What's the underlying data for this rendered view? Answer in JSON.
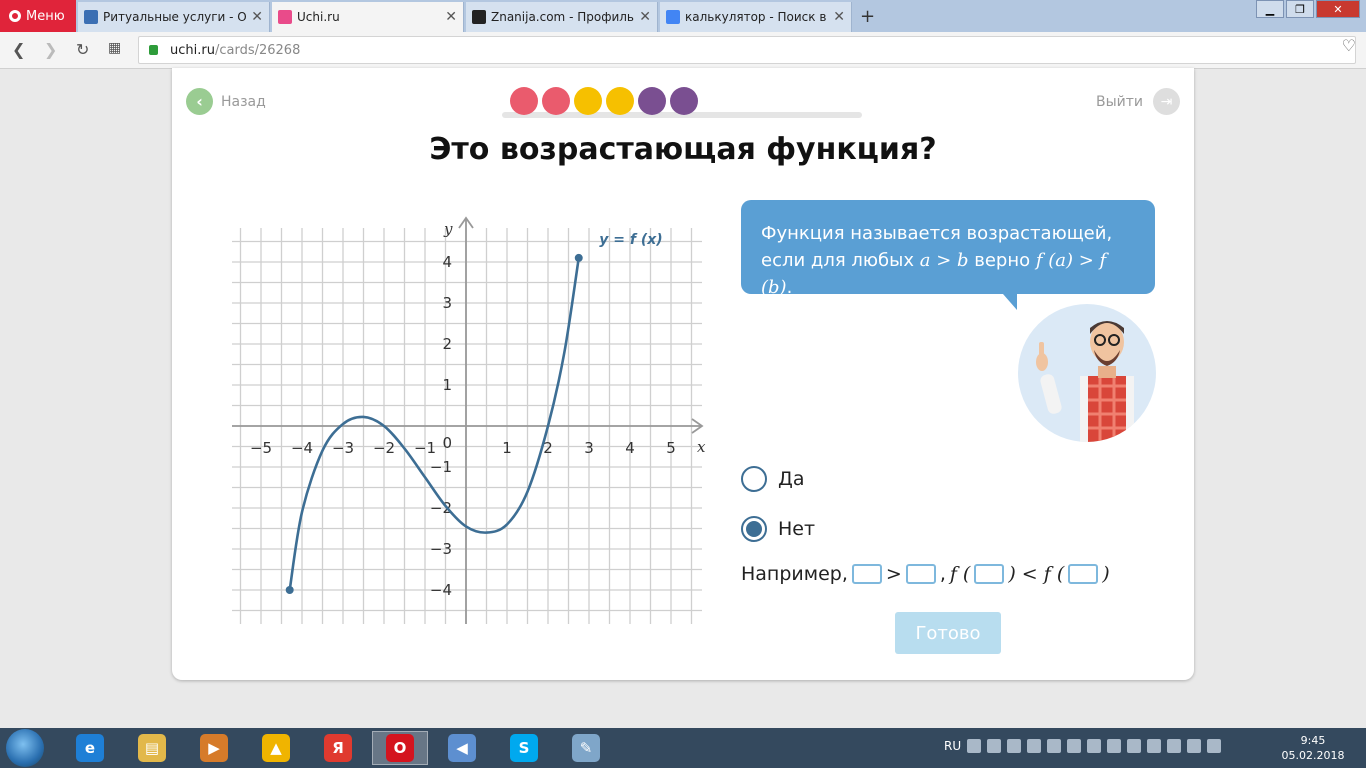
{
  "browser": {
    "menu_label": "Меню",
    "tabs": [
      {
        "title": "Ритуальные услуги - Обр",
        "favicon_color": "#3b6fb3",
        "active": false
      },
      {
        "title": "Uchi.ru",
        "favicon_color": "#e94b8a",
        "active": true
      },
      {
        "title": "Znanija.com - Профиль по",
        "favicon_color": "#222222",
        "active": false
      },
      {
        "title": "калькулятор - Поиск в Go",
        "favicon_color": "#4285f4",
        "active": false
      }
    ],
    "url_host": "uchi.ru",
    "url_path": "/cards/26268"
  },
  "lesson": {
    "back_label": "Назад",
    "exit_label": "Выйти",
    "progress_dot_colors": [
      "#ea5b6d",
      "#ea5b6d",
      "#f6c000",
      "#f6c000",
      "#7a4f91",
      "#7a4f91"
    ],
    "title": "Это возрастающая функция?",
    "hint_line1": "Функция называется возрастающей,",
    "hint_line2_pre": "если для любых ",
    "hint_line2_math1": "a > b",
    "hint_line2_mid": " верно ",
    "hint_line2_math2": "f (a) > f (b)",
    "hint_line2_end": ".",
    "options": [
      {
        "label": "Да",
        "selected": false
      },
      {
        "label": "Нет",
        "selected": true
      }
    ],
    "example_prefix": "Например,",
    "example_gt": ">",
    "example_comma": ",",
    "example_f1": "f (",
    "example_lt": ") < f (",
    "example_close": ")",
    "done_label": "Готово"
  },
  "chart_data": {
    "type": "line",
    "title": "",
    "series_label": "y = f (x)",
    "xlabel": "x",
    "ylabel": "y",
    "origin_label": "0",
    "xlim": [
      -5.5,
      5.5
    ],
    "ylim": [
      -4.7,
      4.6
    ],
    "x_ticks": [
      -5,
      -4,
      -3,
      -2,
      -1,
      1,
      2,
      3,
      4,
      5
    ],
    "x_tick_labels": [
      "−5",
      "−4",
      "−3",
      "−2",
      "−1",
      "1",
      "2",
      "3",
      "4",
      "5"
    ],
    "y_ticks": [
      4,
      3,
      2,
      1,
      -1,
      -2,
      -3,
      -4
    ],
    "y_tick_labels": [
      "4",
      "3",
      "2",
      "1",
      "−1",
      "−2",
      "−3",
      "−4"
    ],
    "grid": true,
    "line_color": "#3d6e94",
    "points": [
      [
        -4.3,
        -4.0
      ],
      [
        -4.0,
        -2.1
      ],
      [
        -3.5,
        -0.6
      ],
      [
        -3.0,
        0.05
      ],
      [
        -2.5,
        0.22
      ],
      [
        -2.0,
        0.0
      ],
      [
        -1.5,
        -0.55
      ],
      [
        -1.0,
        -1.25
      ],
      [
        -0.5,
        -1.95
      ],
      [
        0.0,
        -2.45
      ],
      [
        0.5,
        -2.6
      ],
      [
        1.0,
        -2.4
      ],
      [
        1.5,
        -1.6
      ],
      [
        2.0,
        0.0
      ],
      [
        2.4,
        1.8
      ],
      [
        2.75,
        4.1
      ]
    ]
  },
  "taskbar": {
    "apps": [
      {
        "name": "ie",
        "color": "#1e7fd6",
        "glyph": "e"
      },
      {
        "name": "explorer",
        "color": "#e2b84a",
        "glyph": "▤"
      },
      {
        "name": "media-player",
        "color": "#d67b2a",
        "glyph": "▶"
      },
      {
        "name": "aimp",
        "color": "#f0b400",
        "glyph": "▲"
      },
      {
        "name": "yandex",
        "color": "#e03a2f",
        "glyph": "Я"
      },
      {
        "name": "opera",
        "color": "#d4141e",
        "glyph": "O"
      },
      {
        "name": "volume-app",
        "color": "#5d8fd0",
        "glyph": "◀"
      },
      {
        "name": "skype",
        "color": "#00a9ef",
        "glyph": "S"
      },
      {
        "name": "paint",
        "color": "#7fa6c9",
        "glyph": "✎"
      }
    ],
    "lang": "RU",
    "time": "9:45",
    "date": "05.02.2018"
  }
}
